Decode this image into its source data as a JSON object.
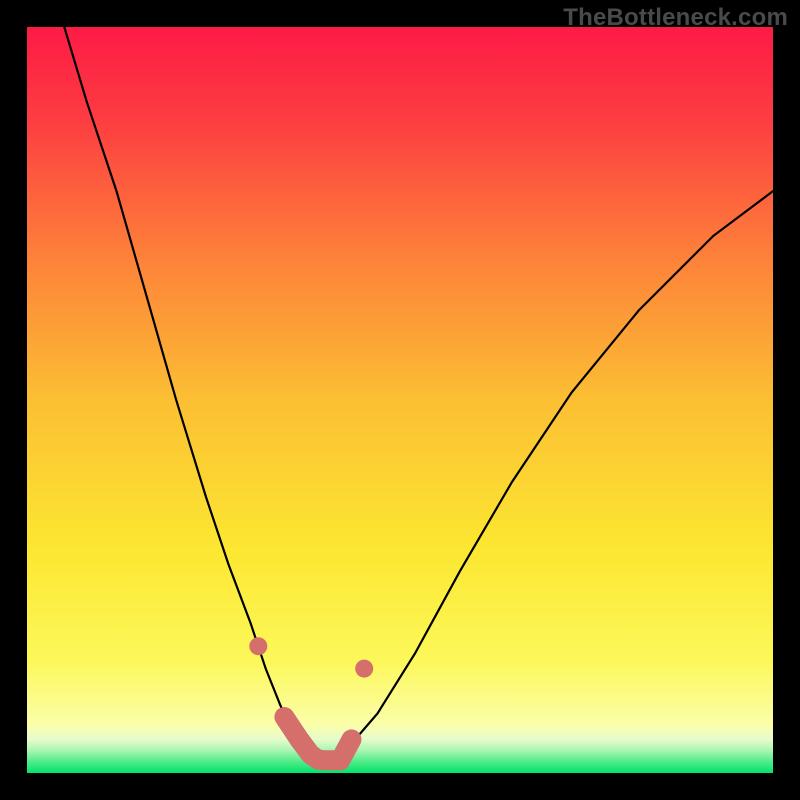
{
  "watermark": "TheBottleneck.com",
  "chart_data": {
    "type": "line",
    "title": "",
    "xlabel": "",
    "ylabel": "",
    "xlim": [
      0,
      100
    ],
    "ylim": [
      0,
      100
    ],
    "grid": false,
    "legend": false,
    "background_gradient": {
      "top_color": "#fd1b46",
      "mid_color": "#fce731",
      "bottom_band_color": "#00e46a"
    },
    "series": [
      {
        "name": "bottleneck-curve",
        "x": [
          5,
          8,
          12,
          16,
          20,
          24,
          27,
          30,
          32,
          34,
          35.5,
          37,
          38,
          39,
          40,
          41,
          42,
          44,
          47,
          52,
          58,
          65,
          73,
          82,
          92,
          100
        ],
        "y": [
          100,
          90,
          78,
          64,
          50,
          37,
          28,
          20,
          14,
          9,
          6,
          4,
          2.5,
          1.8,
          1.5,
          1.8,
          2.5,
          4.5,
          8,
          16,
          27,
          39,
          51,
          62,
          72,
          78
        ]
      }
    ],
    "markers": {
      "comment": "highlighted segment near the curve minimum",
      "color": "#d46f6c",
      "points_x": [
        31,
        34.5,
        36.5,
        38,
        39,
        40,
        41,
        42,
        43.5,
        45.2
      ],
      "points_y": [
        17,
        7.5,
        4.5,
        2.5,
        1.8,
        1.7,
        1.7,
        1.7,
        4.5,
        14
      ],
      "thick_segment_x": [
        34.5,
        36.5,
        38,
        39,
        40,
        41,
        42,
        43.5
      ],
      "thick_segment_y": [
        7.5,
        4.5,
        2.5,
        1.8,
        1.7,
        1.7,
        1.7,
        4.5
      ]
    }
  }
}
